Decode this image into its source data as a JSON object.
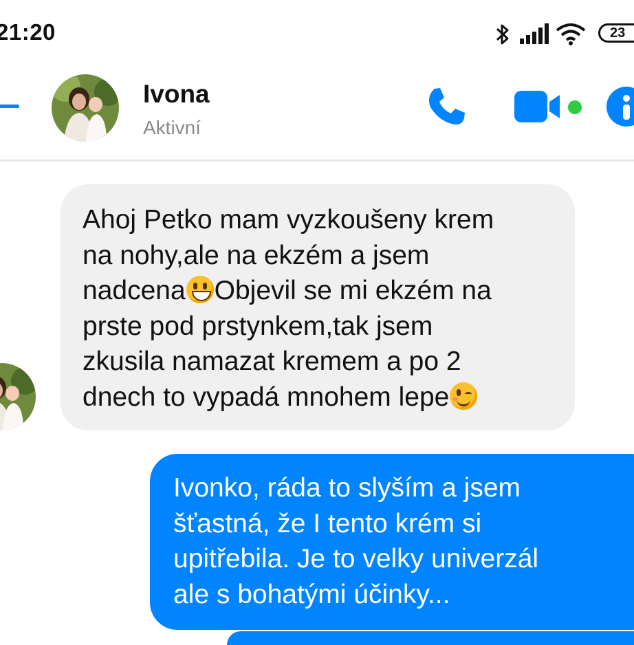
{
  "status_bar": {
    "time": "21:20",
    "battery": "23",
    "icons": [
      "bluetooth-icon",
      "signal-icon",
      "wifi-icon",
      "battery-icon"
    ]
  },
  "header": {
    "contact_name": "Ivona",
    "contact_status": "Aktivní",
    "icons": [
      "back-arrow-icon",
      "phone-icon",
      "video-camera-icon",
      "info-icon"
    ],
    "active_color": "#2ecc40"
  },
  "colors": {
    "accent": "#0084ff",
    "incoming_bubble": "#f0f0f0",
    "outgoing_text": "#ffffff"
  },
  "messages": {
    "incoming": {
      "lines": {
        "l1": "Ahoj Petko mam vyzkoušeny krem",
        "l2": "na nohy,ale na ekzém a jsem",
        "l3a": "nadcena",
        "l3b": "Objevil se mi ekzém na",
        "l4": "prste pod prstynkem,tak jsem",
        "l5": "zkusila namazat kremem a po 2",
        "l6": "dnech to vypadá mnohem lepe"
      },
      "emojis": [
        "grinning-face-emoji",
        "winking-face-emoji"
      ]
    },
    "outgoing": {
      "lines": {
        "l1": "Ivonko, ráda to slyším a jsem",
        "l2": "šťastná, že I tento krém si",
        "l3": "upitřebila. Je to velky univerzál",
        "l4": "ale s bohatými účinky..."
      }
    }
  }
}
